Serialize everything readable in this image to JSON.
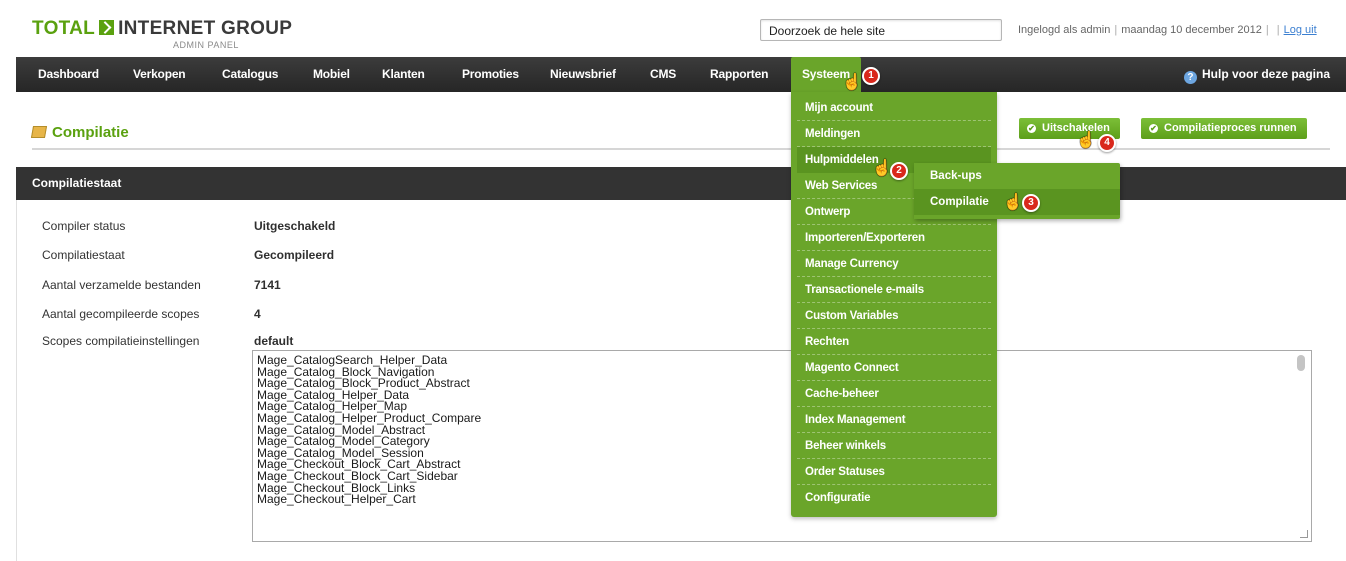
{
  "header": {
    "logo_part1": "TOTAL",
    "logo_part2": "INTERNET GROUP",
    "logo_sub": "ADMIN PANEL",
    "search_value": "Doorzoek de hele site",
    "user_text": "Ingelogd als admin",
    "date_text": "maandag 10 december 2012",
    "logout_label": "Log uit"
  },
  "nav": {
    "items": [
      "Dashboard",
      "Verkopen",
      "Catalogus",
      "Mobiel",
      "Klanten",
      "Promoties",
      "Nieuwsbrief",
      "CMS",
      "Rapporten",
      "Systeem"
    ],
    "help_label": "Hulp voor deze pagina"
  },
  "page": {
    "title": "Compilatie",
    "btn_disable": "Uitschakelen",
    "btn_run": "Compilatieproces runnen"
  },
  "section": {
    "title": "Compilatiestaat",
    "rows": [
      {
        "label": "Compiler status",
        "value": "Uitgeschakeld"
      },
      {
        "label": "Compilatiestaat",
        "value": "Gecompileerd"
      },
      {
        "label": "Aantal verzamelde bestanden",
        "value": "7141"
      },
      {
        "label": "Aantal gecompileerde scopes",
        "value": "4"
      },
      {
        "label": "Scopes compilatieinstellingen",
        "value": "default"
      }
    ],
    "scopes": [
      "Mage_CatalogSearch_Helper_Data",
      "Mage_Catalog_Block_Navigation",
      "Mage_Catalog_Block_Product_Abstract",
      "Mage_Catalog_Helper_Data",
      "Mage_Catalog_Helper_Map",
      "Mage_Catalog_Helper_Product_Compare",
      "Mage_Catalog_Model_Abstract",
      "Mage_Catalog_Model_Category",
      "Mage_Catalog_Model_Session",
      "Mage_Checkout_Block_Cart_Abstract",
      "Mage_Checkout_Block_Cart_Sidebar",
      "Mage_Checkout_Block_Links",
      "Mage_Checkout_Helper_Cart"
    ]
  },
  "dropdown": {
    "items": [
      "Mijn account",
      "Meldingen",
      "Hulpmiddelen",
      "Web Services",
      "Ontwerp",
      "Importeren/Exporteren",
      "Manage Currency",
      "Transactionele e-mails",
      "Custom Variables",
      "Rechten",
      "Magento Connect",
      "Cache-beheer",
      "Index Management",
      "Beheer winkels",
      "Order Statuses",
      "Configuratie"
    ]
  },
  "submenu": {
    "items": [
      "Back-ups",
      "Compilatie"
    ]
  },
  "badges": [
    "1",
    "2",
    "3",
    "4"
  ],
  "colors": {
    "accent_green": "#6aa52a",
    "nav_dark": "#2e2e2e",
    "badge_red": "#d9281c",
    "title_green": "#5aa10f"
  }
}
